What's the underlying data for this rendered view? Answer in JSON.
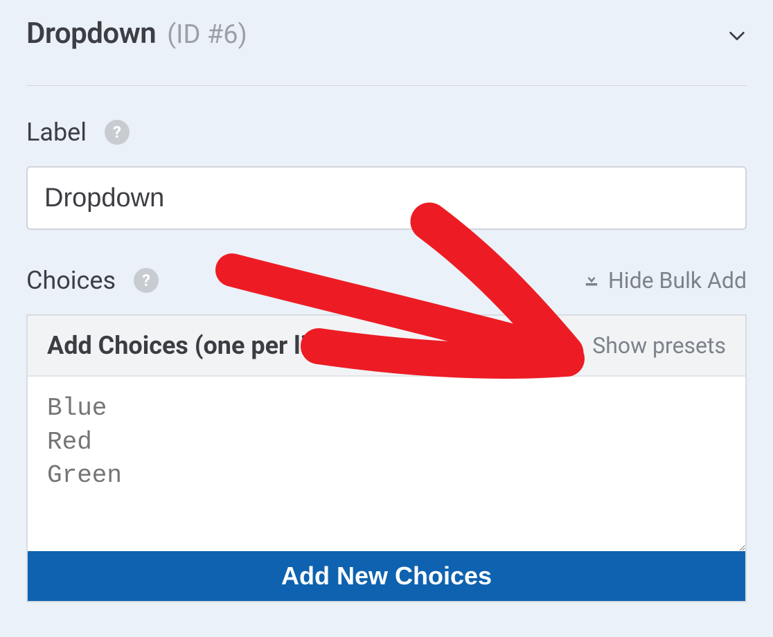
{
  "header": {
    "title": "Dropdown",
    "id_label": "(ID #6)"
  },
  "label_section": {
    "heading": "Label",
    "value": "Dropdown"
  },
  "choices_section": {
    "heading": "Choices",
    "hide_bulk_label": "Hide Bulk Add",
    "bulk_title": "Add Choices (one per line)",
    "show_presets": "Show presets",
    "placeholder": "Blue\nRed\nGreen",
    "add_button": "Add New Choices"
  }
}
